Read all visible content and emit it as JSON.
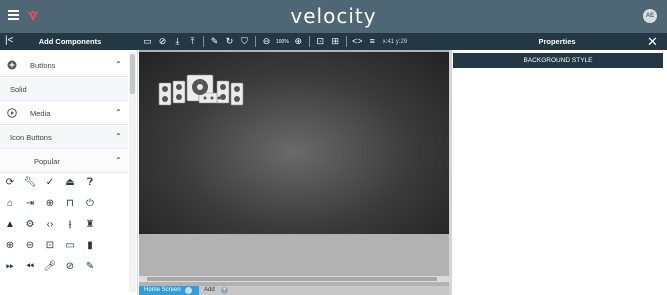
{
  "header": {
    "brand": "velocity",
    "avatar_initials": "AE"
  },
  "left_panel": {
    "title": "Add Components",
    "sections": [
      {
        "label": "Buttons",
        "icon": "plus-circle-icon",
        "expanded": true
      },
      {
        "label": "Solid",
        "sub": true
      },
      {
        "label": "Media",
        "icon": "play-circle-icon",
        "expanded": true
      },
      {
        "label": "Icon Buttons",
        "sub": true
      },
      {
        "label": "Popular",
        "sub": true,
        "expanded": true
      }
    ],
    "icon_grid": [
      [
        "refresh-icon",
        "wrench-icon",
        "check-icon",
        "eject-icon",
        "help-icon"
      ],
      [
        "home-icon",
        "input-icon",
        "globe-icon",
        "lock-icon",
        "power-icon"
      ],
      [
        "warning-icon",
        "gear-icon",
        "code-icon",
        "mixer-icon",
        "mic-stand-icon"
      ],
      [
        "zoom-in-icon",
        "zoom-out-icon",
        "screen-icon",
        "cast-icon",
        "bar-chart-icon"
      ],
      [
        "fast-forward-icon",
        "rewind-icon",
        "mic-icon",
        "mute-mic-icon",
        "screen-edit-icon"
      ]
    ]
  },
  "toolbar": {
    "zoom_label": "100%",
    "coords": "x:41 y:29"
  },
  "canvas": {
    "tabs": [
      {
        "label": "Home Screen",
        "active": true
      },
      {
        "label": "Add",
        "active": false
      }
    ]
  },
  "right_panel": {
    "title": "Properties",
    "section_label": "BACKGROUND STYLE"
  },
  "colors": {
    "topbar": "#4f6775",
    "subbar": "#243744",
    "accent": "#2e9ee0"
  }
}
